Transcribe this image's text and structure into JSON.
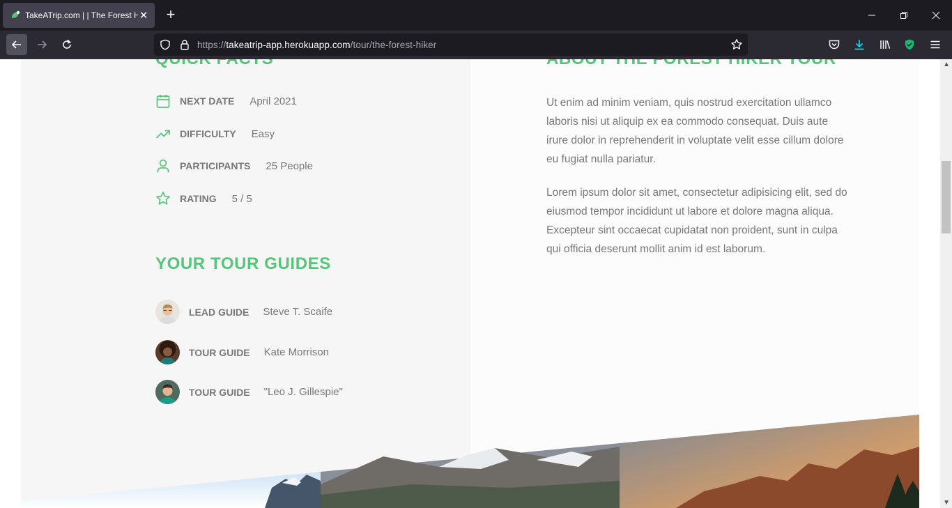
{
  "browser": {
    "tab_title": "TakeATrip.com | | The Forest Hiker",
    "url_host": "takeatrip-app.herokuapp.com",
    "url_prefix": "https://",
    "url_path": "/tour/the-forest-hiker"
  },
  "quick_facts": {
    "heading": "QUICK FACTS",
    "items": [
      {
        "label": "NEXT DATE",
        "text": "April 2021",
        "icon": "calendar-icon"
      },
      {
        "label": "DIFFICULTY",
        "text": "Easy",
        "icon": "trending-up-icon"
      },
      {
        "label": "PARTICIPANTS",
        "text": "25 People",
        "icon": "user-icon"
      },
      {
        "label": "RATING",
        "text": "5 / 5",
        "icon": "star-icon"
      }
    ]
  },
  "guides": {
    "heading": "YOUR TOUR GUIDES",
    "items": [
      {
        "role": "LEAD GUIDE",
        "name": "Steve T. Scaife"
      },
      {
        "role": "TOUR GUIDE",
        "name": "Kate Morrison"
      },
      {
        "role": "TOUR GUIDE",
        "name": "\"Leo J. Gillespie\""
      }
    ]
  },
  "about": {
    "heading": "ABOUT THE FOREST HIKER TOUR",
    "paragraphs": [
      "Ut enim ad minim veniam, quis nostrud exercitation ullamco laboris nisi ut aliquip ex ea commodo consequat. Duis aute irure dolor in reprehenderit in voluptate velit esse cillum dolore eu fugiat nulla pariatur.",
      "Lorem ipsum dolor sit amet, consectetur adipisicing elit, sed do eiusmod tempor incididunt ut labore et dolore magna aliqua. Excepteur sint occaecat cupidatat non proident, sunt in culpa qui officia deserunt mollit anim id est laborum."
    ]
  },
  "colors": {
    "brand_green": "#55c57a",
    "text_grey": "#777777"
  }
}
